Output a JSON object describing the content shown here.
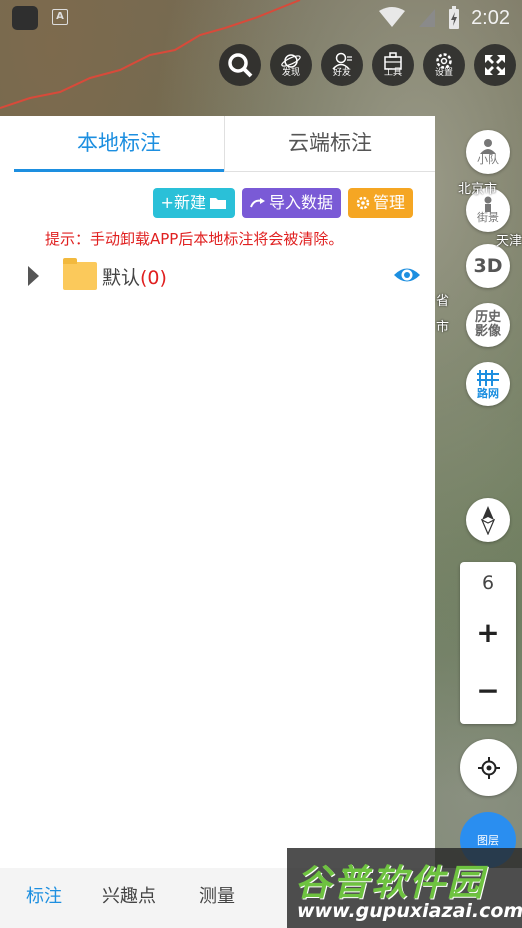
{
  "status_bar": {
    "time": "2:02"
  },
  "top_tools": [
    {
      "icon": "search-icon",
      "label": ""
    },
    {
      "icon": "planet-icon",
      "label": "发现"
    },
    {
      "icon": "friends-icon",
      "label": "好友"
    },
    {
      "icon": "toolbox-icon",
      "label": "工具"
    },
    {
      "icon": "gear-icon",
      "label": "设置"
    },
    {
      "icon": "fullscreen-icon",
      "label": ""
    }
  ],
  "tabs": {
    "local": "本地标注",
    "cloud": "云端标注"
  },
  "actions": {
    "new": "+新建",
    "import": "导入数据",
    "manage": "管理"
  },
  "tip": "提示：手动卸载APP后本地标注将会被清除。",
  "folder": {
    "name": "默认",
    "count": "(0)"
  },
  "right_buttons": {
    "team": "小队",
    "street": "街景",
    "three_d": "3D",
    "history_line1": "历史",
    "history_line2": "影像",
    "roads": "路网"
  },
  "map_labels": {
    "beijing": "北京市",
    "tianjin": "天津",
    "shi": "市",
    "sheng": "省"
  },
  "zoom": {
    "level": "6",
    "in": "+",
    "out": "−"
  },
  "toggle": {
    "label": "图层"
  },
  "bottom_tabs": {
    "mark": "标注",
    "poi": "兴趣点",
    "measure": "测量"
  },
  "watermark": {
    "brand": "谷普软件园",
    "url": "www.gupuxiazai.com"
  },
  "colors": {
    "accent": "#1d8fe0",
    "tip": "#e02020",
    "new_btn": "#2ac0d8",
    "import_btn": "#7a5ad6",
    "manage_btn": "#f5a623"
  }
}
